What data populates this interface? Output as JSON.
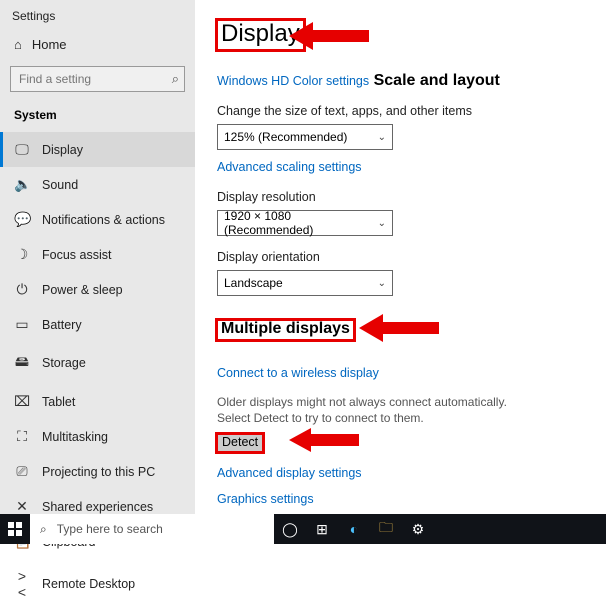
{
  "window_title": "Settings",
  "home_label": "Home",
  "search_placeholder": "Find a setting",
  "group": "System",
  "nav": [
    {
      "icon": "🖵",
      "label": "Display",
      "sel": true
    },
    {
      "icon": "🔈",
      "label": "Sound"
    },
    {
      "icon": "💬",
      "label": "Notifications & actions"
    },
    {
      "icon": "☽",
      "label": "Focus assist"
    },
    {
      "icon": "⏻",
      "label": "Power & sleep"
    },
    {
      "icon": "▭",
      "label": "Battery"
    },
    {
      "icon": "🖴",
      "label": "Storage"
    },
    {
      "icon": "⌧",
      "label": "Tablet"
    },
    {
      "icon": "⛶",
      "label": "Multitasking"
    },
    {
      "icon": "⎚",
      "label": "Projecting to this PC"
    },
    {
      "icon": "✕",
      "label": "Shared experiences"
    },
    {
      "icon": "📋",
      "label": "Clipboard"
    },
    {
      "icon": "><",
      "label": "Remote Desktop"
    }
  ],
  "page": {
    "title": "Display",
    "hdcolor_link": "Windows HD Color settings",
    "scale_heading": "Scale and layout",
    "scale_label": "Change the size of text, apps, and other items",
    "scale_value": "125% (Recommended)",
    "adv_scaling_link": "Advanced scaling settings",
    "res_label": "Display resolution",
    "res_value": "1920 × 1080 (Recommended)",
    "orient_label": "Display orientation",
    "orient_value": "Landscape",
    "multi_heading": "Multiple displays",
    "wireless_link": "Connect to a wireless display",
    "detect_desc": "Older displays might not always connect automatically. Select Detect to try to connect to them.",
    "detect_btn": "Detect",
    "adv_display_link": "Advanced display settings",
    "graphics_link": "Graphics settings"
  },
  "taskbar": {
    "search_placeholder": "Type here to search"
  }
}
